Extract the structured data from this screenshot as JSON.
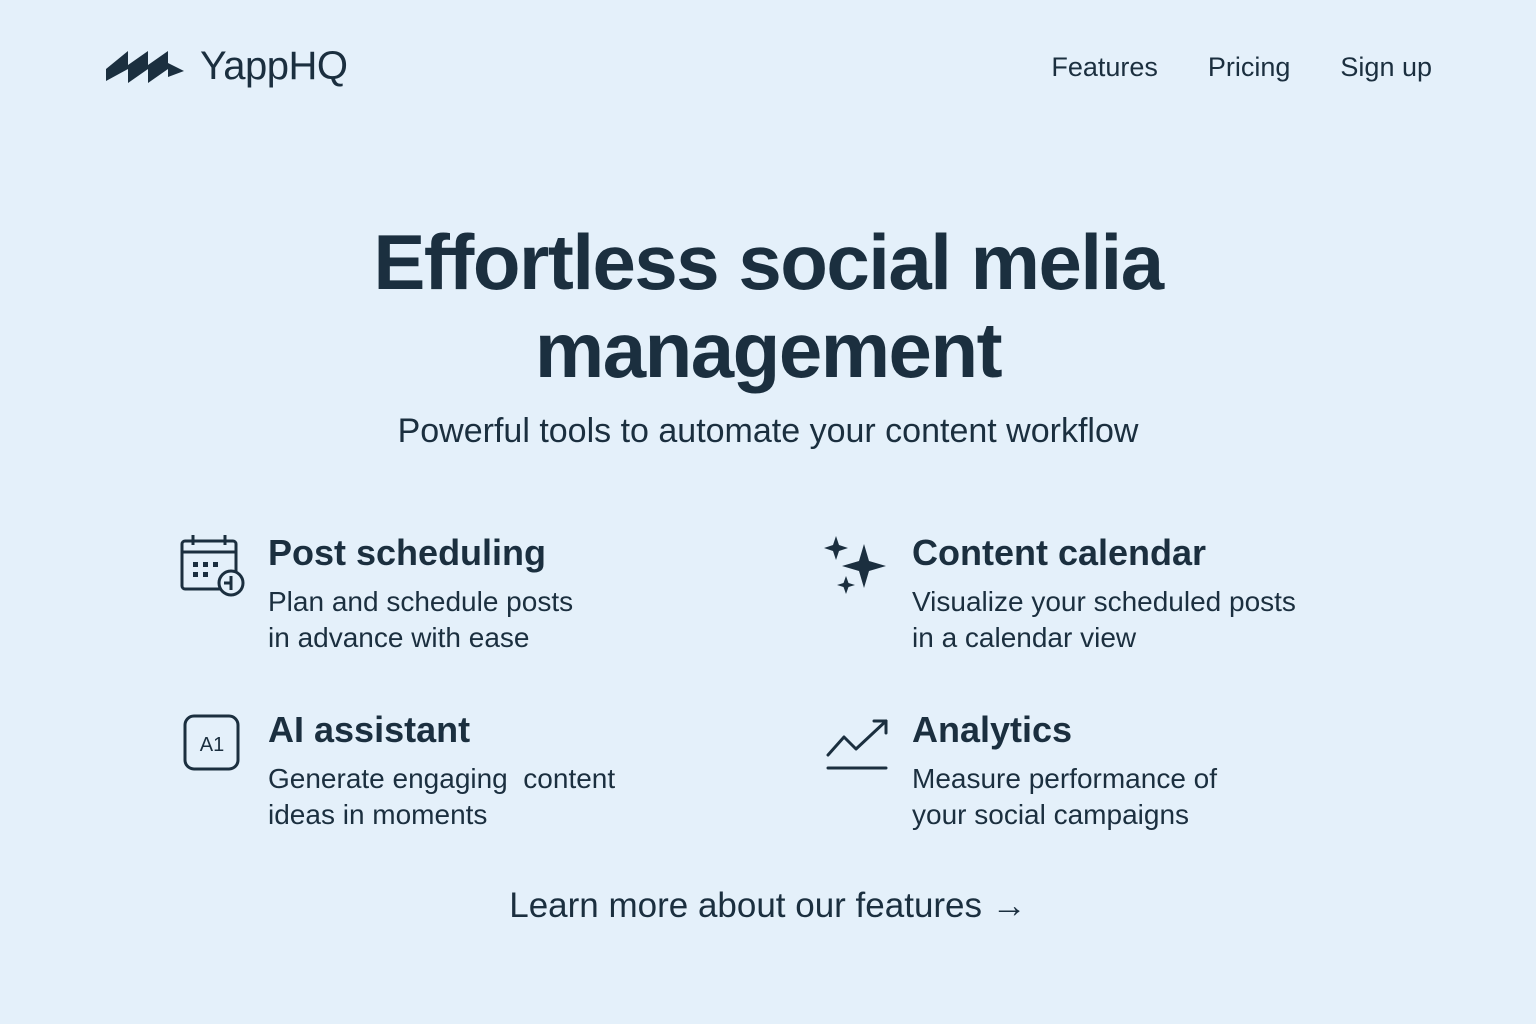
{
  "brand": {
    "name": "YappHQ",
    "logo_icon": "zigzag-logo-icon",
    "text_color": "#1b2f3f",
    "background_color": "#e4f0fa"
  },
  "nav": {
    "items": [
      {
        "label": "Features"
      },
      {
        "label": "Pricing"
      },
      {
        "label": "Sign up"
      }
    ]
  },
  "hero": {
    "title_line1": "Effortless social melia",
    "title_line2": "management",
    "subtitle": "Powerful tools to automate your content workflow"
  },
  "features": [
    {
      "title": "Post scheduling",
      "desc_line1": "Plan and schedule posts",
      "desc_line2": "in advance with ease",
      "icon": "calendar-clock-icon"
    },
    {
      "title": "Content calendar",
      "desc_line1": "Visualize your scheduled posts",
      "desc_line2": "in a calendar view",
      "icon": "sparkles-icon"
    },
    {
      "title": "AI assistant",
      "desc_line1": "Generate engaging  content",
      "desc_line2": "ideas in moments",
      "icon": "ai-box-icon",
      "icon_text": "A1"
    },
    {
      "title": "Analytics",
      "desc_line1": "Measure performance of",
      "desc_line2": "your social campaigns",
      "icon": "trend-up-icon"
    }
  ],
  "cta": {
    "label": "Learn more about our features →"
  }
}
